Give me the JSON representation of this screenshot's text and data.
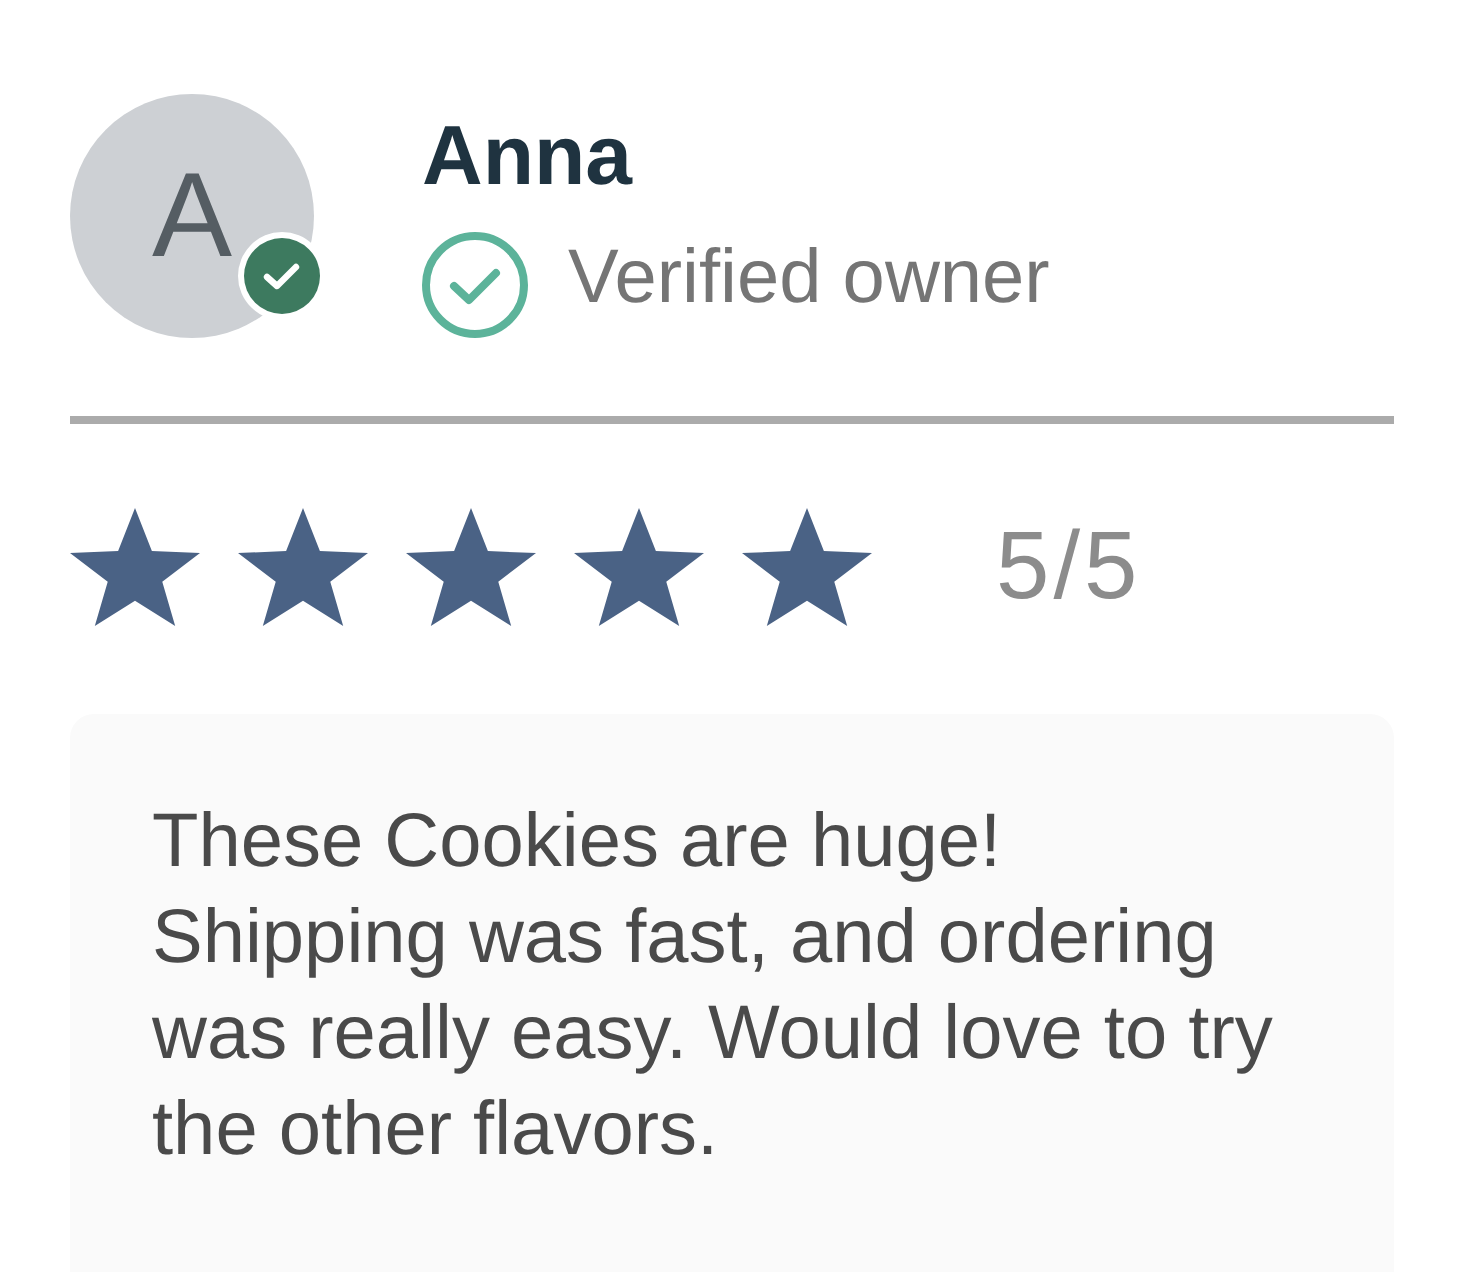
{
  "reviewer": {
    "initial": "A",
    "name": "Anna",
    "verified": true,
    "verified_label": "Verified owner"
  },
  "rating": {
    "stars": 5,
    "score": "5/5"
  },
  "review": {
    "text": "These Cookies are huge! Shipping was fast, and ordering was really easy. Would love to try the other flavors."
  }
}
